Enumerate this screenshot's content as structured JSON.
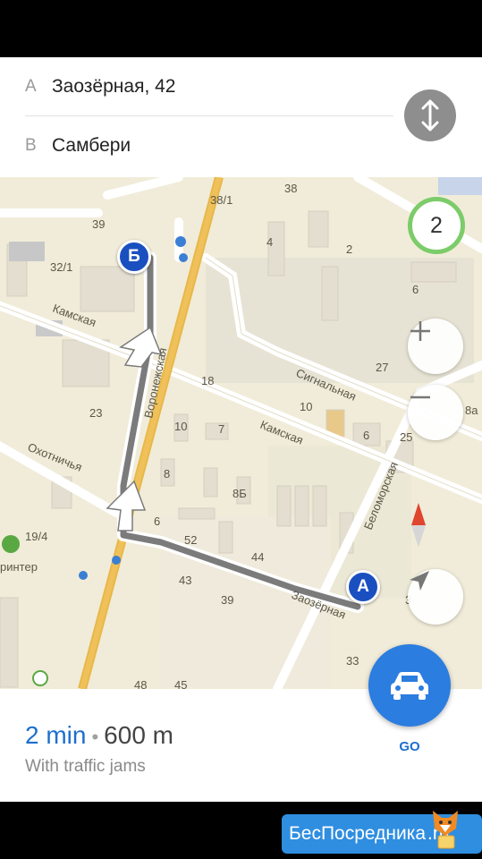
{
  "route": {
    "from_letter": "A",
    "from_address": "Заозёрная, 42",
    "to_letter": "B",
    "to_address": "Самбери"
  },
  "map": {
    "streets": [
      "Камская",
      "Воронежская",
      "Сигнальная",
      "Камская",
      "Охотничья",
      "Беломорская",
      "Заозёрная"
    ],
    "house_numbers": [
      "38/1",
      "38",
      "39",
      "32/1",
      "4",
      "2",
      "6",
      "18",
      "27",
      "10",
      "23",
      "10",
      "7",
      "6",
      "25",
      "8а",
      "8",
      "8Б",
      "6",
      "52",
      "44",
      "19/4",
      "43",
      "39",
      "33",
      "45",
      "3",
      "48"
    ],
    "poi_label": "ринтер",
    "marker_start": "A",
    "marker_end": "Б",
    "traffic_level": "2",
    "traffic_color": "#7ccc6a",
    "route_color": "#7b7b7b"
  },
  "controls": {
    "swap_icon": "swap-vertical-icon",
    "zoom_in_icon": "plus-icon",
    "zoom_out_icon": "minus-icon",
    "compass_icon": "compass-icon",
    "locate_icon": "location-arrow-icon"
  },
  "summary": {
    "time": "2 min",
    "separator": "•",
    "distance": "600 m",
    "note": "With traffic jams"
  },
  "go": {
    "label": "GO",
    "icon": "car-icon",
    "color": "#2b7de0"
  },
  "watermark": {
    "text": "БесПосредника",
    "suffix": ".ru"
  }
}
